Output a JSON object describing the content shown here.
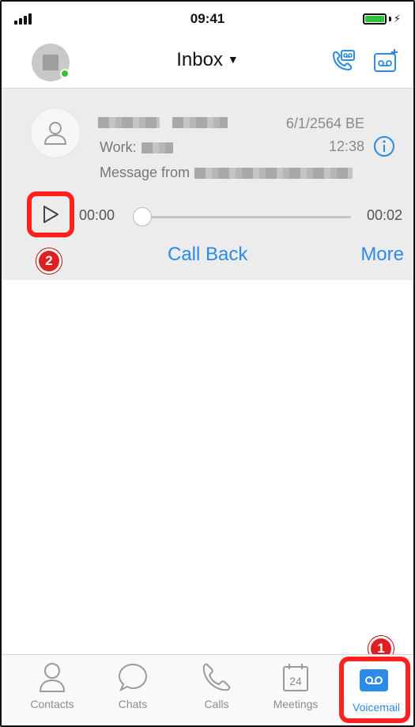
{
  "status_bar": {
    "time": "09:41"
  },
  "header": {
    "title": "Inbox"
  },
  "voicemail": {
    "work_label": "Work:",
    "message_prefix": "Message from",
    "date": "6/1/2564 BE",
    "time": "12:38",
    "player": {
      "start_time": "00:00",
      "end_time": "00:02",
      "progress": 0
    },
    "actions": {
      "call_back": "Call Back",
      "more": "More"
    }
  },
  "markers": {
    "tab_marker": "1",
    "play_marker": "2"
  },
  "tabs": [
    {
      "label": "Contacts"
    },
    {
      "label": "Chats"
    },
    {
      "label": "Calls"
    },
    {
      "label": "Meetings",
      "badge": "24"
    },
    {
      "label": "Voicemail"
    }
  ],
  "colors": {
    "accent": "#2b8be6",
    "highlight": "#ff2020",
    "presence": "#3ac23a",
    "battery": "#30c23f"
  }
}
